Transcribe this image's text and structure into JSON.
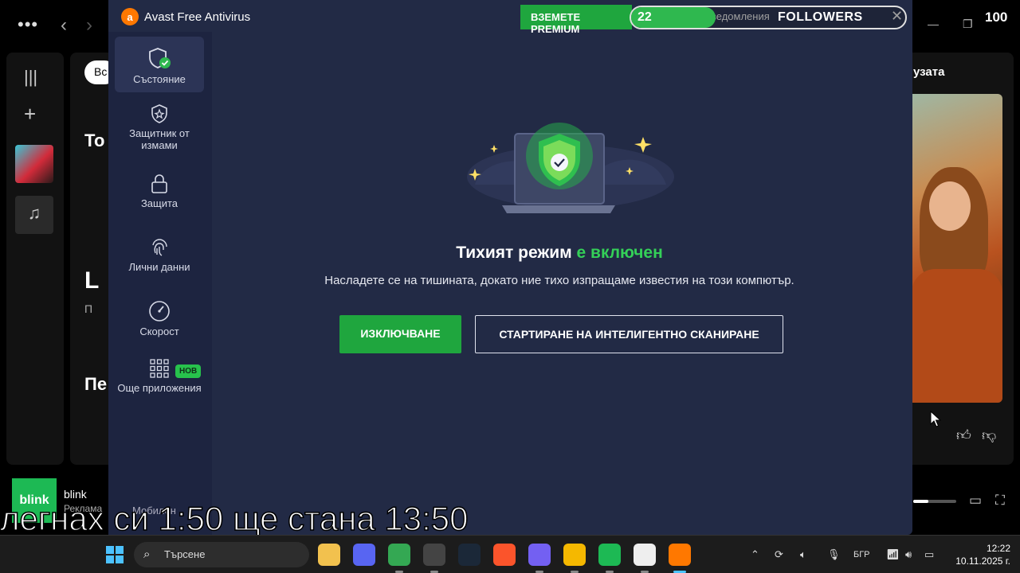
{
  "spotify": {
    "chip": "Вс",
    "heading_top": "То",
    "heading_mid": "Пе",
    "letter_l": "L",
    "letter_p": "П",
    "right_title": "узата",
    "ad_logo": "blink",
    "ad_name": "blink",
    "ad_sub": "Реклама",
    "ad_progress": 0.35
  },
  "avast": {
    "app_title": "Avast Free Antivirus",
    "logo_glyph": "a",
    "premium_label": "ВЗЕМЕТЕ PREMIUM",
    "notifications_label": "ведомления",
    "sidebar": [
      {
        "label": "Състояние",
        "icon": "shield-check-icon",
        "active": true
      },
      {
        "label": "Защитник от измами",
        "icon": "shield-star-icon",
        "active": false
      },
      {
        "label": "Защита",
        "icon": "lock-icon",
        "active": false
      },
      {
        "label": "Лични данни",
        "icon": "fingerprint-icon",
        "active": false
      },
      {
        "label": "Скорост",
        "icon": "speedometer-icon",
        "active": false
      },
      {
        "label": "Още приложения",
        "icon": "grid-icon",
        "active": false,
        "badge": "НОВ"
      }
    ],
    "mobile_label": "Мобилен",
    "main": {
      "title_part1": "Тихият режим",
      "title_part2": "е включен",
      "description": "Насладете се на тишината, докато ние тихо изпращаме известия на този компютър.",
      "btn_turn_off": "ИЗКЛЮЧВАНЕ",
      "btn_smart_scan": "СТАРТИРАНЕ НА ИНТЕЛИГЕНТНО СКАНИРАНЕ"
    }
  },
  "followers": {
    "count": "22",
    "label": "FOLLOWERS",
    "goal": "100",
    "progress": 0.22
  },
  "subtitle": "легнах си 1:50 ще стана 13:50",
  "taskbar": {
    "search_placeholder": "Търсене",
    "language": "БГР",
    "time": "12:22",
    "date": "10.11.2025 г.",
    "apps": [
      {
        "name": "file-explorer",
        "color": "#f2c14e"
      },
      {
        "name": "discord",
        "color": "#5865f2"
      },
      {
        "name": "chrome",
        "color": "#34a853"
      },
      {
        "name": "obs",
        "color": "#444444"
      },
      {
        "name": "steam",
        "color": "#1b2838"
      },
      {
        "name": "brave",
        "color": "#fb542b"
      },
      {
        "name": "viber",
        "color": "#7360f2"
      },
      {
        "name": "coin-app",
        "color": "#f5b800"
      },
      {
        "name": "spotify",
        "color": "#1db954"
      },
      {
        "name": "notepad",
        "color": "#eeeeee"
      },
      {
        "name": "avast",
        "color": "#ff7800"
      }
    ]
  },
  "colors": {
    "avast_bg": "#222a45",
    "avast_sidebar": "#1d2440",
    "accent_green": "#1fa63e",
    "avast_orange": "#ff7800"
  }
}
